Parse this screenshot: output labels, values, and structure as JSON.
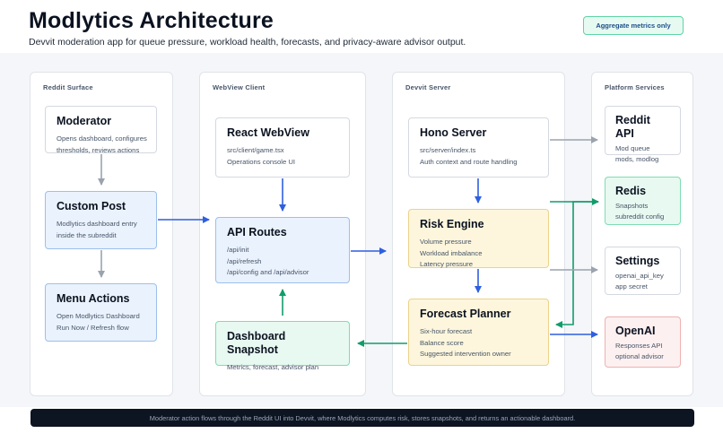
{
  "header": {
    "title": "Modlytics Architecture",
    "subtitle": "Devvit moderation app for queue pressure, workload health, forecasts, and privacy-aware advisor output.",
    "badge": "Aggregate metrics only"
  },
  "lanes": {
    "reddit_surface": "Reddit Surface",
    "webview_client": "WebView Client",
    "devvit_server": "Devvit Server",
    "platform_services": "Platform Services"
  },
  "nodes": {
    "moderator": {
      "title": "Moderator",
      "lines": [
        "Opens dashboard, configures",
        "thresholds, reviews actions"
      ]
    },
    "custom_post": {
      "title": "Custom Post",
      "lines": [
        "Modlytics dashboard entry",
        "inside the subreddit"
      ]
    },
    "menu_actions": {
      "title": "Menu Actions",
      "lines": [
        "Open Modlytics Dashboard",
        "Run Now / Refresh flow"
      ]
    },
    "react_webview": {
      "title": "React WebView",
      "lines": [
        "src/client/game.tsx",
        "Operations console UI"
      ]
    },
    "api_routes": {
      "title": "API Routes",
      "lines": [
        "/api/init",
        "/api/refresh",
        "/api/config and /api/advisor"
      ]
    },
    "dashboard_snapshot": {
      "title": "Dashboard Snapshot",
      "lines": [
        "Metrics, forecast, advisor plan"
      ]
    },
    "hono_server": {
      "title": "Hono Server",
      "lines": [
        "src/server/index.ts",
        "Auth context and route handling"
      ]
    },
    "risk_engine": {
      "title": "Risk Engine",
      "lines": [
        "Volume pressure",
        "Workload imbalance",
        "Latency pressure"
      ]
    },
    "forecast_planner": {
      "title": "Forecast Planner",
      "lines": [
        "Six-hour forecast",
        "Balance score",
        "Suggested intervention owner"
      ]
    },
    "reddit_api": {
      "title": "Reddit API",
      "lines": [
        "Mod queue",
        "mods, modlog"
      ]
    },
    "redis": {
      "title": "Redis",
      "lines": [
        "Snapshots",
        "subreddit config"
      ]
    },
    "settings": {
      "title": "Settings",
      "lines": [
        "openai_api_key",
        "app secret"
      ]
    },
    "openai": {
      "title": "OpenAI",
      "lines": [
        "Responses API",
        "optional advisor"
      ]
    }
  },
  "footer": "Moderator action flows through the Reddit UI into Devvit, where Modlytics computes risk, stores snapshots, and returns an actionable dashboard.",
  "colors": {
    "flow_blue": "#2f5fe0",
    "store_green": "#129c6b",
    "muted_gray": "#9aa3ae",
    "client_blue": "#eaf2fd",
    "engine_yellow": "#fdf6dc",
    "storage_green": "#e8f9f1",
    "external_red": "#fdf0f0"
  }
}
